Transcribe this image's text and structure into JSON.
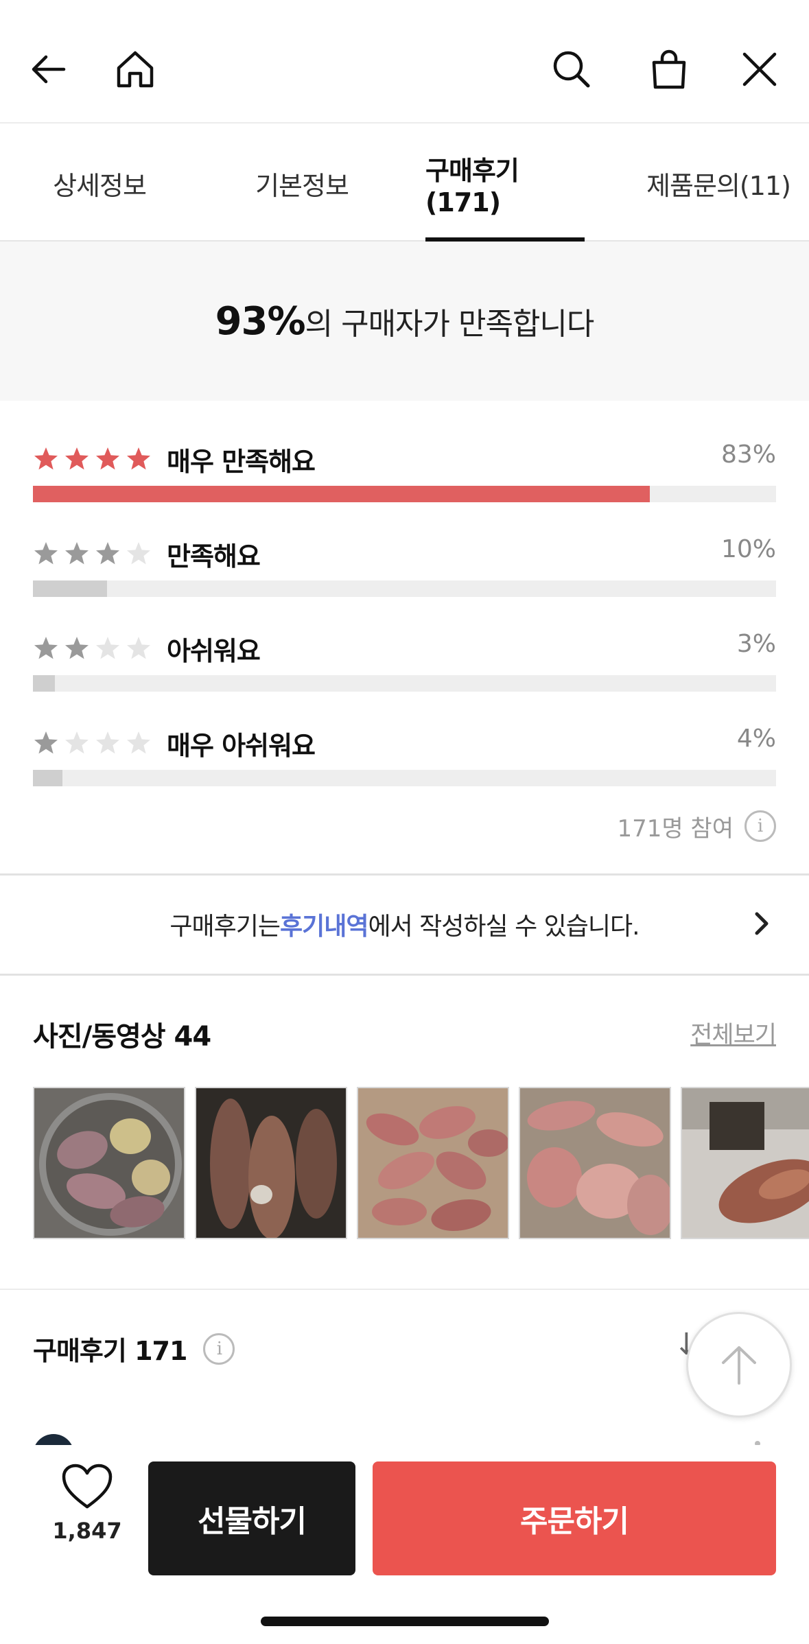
{
  "header": {
    "icons": [
      "back-arrow-icon",
      "home-icon",
      "search-icon",
      "shopping-bag-icon",
      "close-icon"
    ]
  },
  "tabs": [
    {
      "label": "상세정보",
      "active": false
    },
    {
      "label": "기본정보",
      "active": false
    },
    {
      "label": "구매후기(171)",
      "active": true
    },
    {
      "label": "제품문의(11)",
      "active": false
    }
  ],
  "satisfaction": {
    "percent": "93%",
    "text": "의 구매자가 만족합니다"
  },
  "ratings": [
    {
      "stars": 4,
      "label": "매우 만족해요",
      "percent_text": "83%",
      "percent": 83,
      "highlight": true
    },
    {
      "stars": 3,
      "label": "만족해요",
      "percent_text": "10%",
      "percent": 10,
      "highlight": false
    },
    {
      "stars": 2,
      "label": "아쉬워요",
      "percent_text": "3%",
      "percent": 3,
      "highlight": false
    },
    {
      "stars": 1,
      "label": "매우 아쉬워요",
      "percent_text": "4%",
      "percent": 4,
      "highlight": false
    }
  ],
  "participants": "171명 참여",
  "write_notice": {
    "prefix": "구매후기는 ",
    "link": "후기내역",
    "suffix": "에서 작성하실 수 있습니다."
  },
  "media": {
    "title": "사진/동영상 44",
    "view_all": "전체보기"
  },
  "reviews": {
    "title": "구매후기 171"
  },
  "bottom": {
    "like_count": "1,847",
    "gift_label": "선물하기",
    "order_label": "주문하기"
  },
  "colors": {
    "accent_red": "#eb544f",
    "star_red": "#e05a5a",
    "link_blue": "#5a73d6"
  }
}
